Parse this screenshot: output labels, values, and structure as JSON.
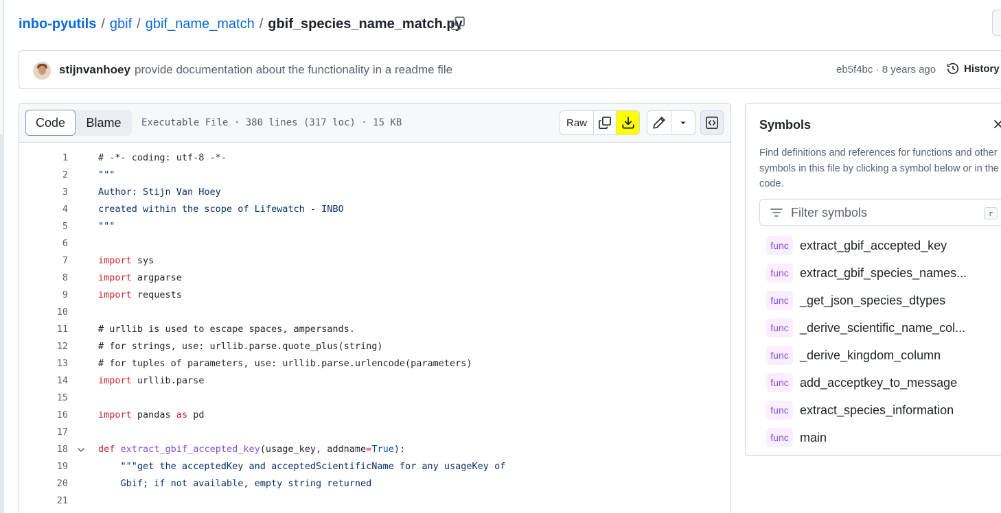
{
  "breadcrumb": {
    "repo": "inbo-pyutils",
    "dir1": "gbif",
    "dir2": "gbif_name_match",
    "file": "gbif_species_name_match.py",
    "separator": "/"
  },
  "commit": {
    "author": "stijnvanhoey",
    "message": "provide documentation about the functionality in a readme file",
    "meta": "eb5f4bc · 8 years ago",
    "history_label": "History"
  },
  "viewer": {
    "tabs": [
      "Code",
      "Blame"
    ],
    "active_tab": "Code",
    "file_info": "Executable File · 380 lines (317 loc) · 15 KB",
    "raw_label": "Raw",
    "download_highlight_color": "#ffff00"
  },
  "code_lines": [
    {
      "n": "1",
      "t": "# -*- coding: utf-8 -*-"
    },
    {
      "n": "2",
      "t": "\"\"\""
    },
    {
      "n": "3",
      "t": "Author: Stijn Van Hoey"
    },
    {
      "n": "4",
      "t": "created within the scope of Lifewatch - INBO"
    },
    {
      "n": "5",
      "t": "\"\"\""
    },
    {
      "n": "6",
      "t": ""
    },
    {
      "n": "7",
      "kw": "import",
      "t": " sys"
    },
    {
      "n": "8",
      "kw": "import",
      "t": " argparse"
    },
    {
      "n": "9",
      "kw": "import",
      "t": " requests"
    },
    {
      "n": "10",
      "t": ""
    },
    {
      "n": "11",
      "t": "# urllib is used to escape spaces, ampersands."
    },
    {
      "n": "12",
      "t": "# for strings, use: urllib.parse.quote_plus(string)"
    },
    {
      "n": "13",
      "t": "# for tuples of parameters, use: urllib.parse.urlencode(parameters)"
    },
    {
      "n": "14",
      "kw": "import",
      "t": " urllib.parse"
    },
    {
      "n": "15",
      "t": ""
    },
    {
      "n": "16",
      "kw": "import",
      "t": " pandas ",
      "kw2": "as",
      "t2": " pd"
    },
    {
      "n": "17",
      "t": ""
    },
    {
      "n": "18",
      "def": true,
      "kw": "def",
      "fn": "extract_gbif_accepted_key",
      "t": "(usage_key, addname",
      "op": "=",
      "bl": "True",
      "t2": "):"
    },
    {
      "n": "19",
      "t": "    \"\"\"get the acceptedKey and acceptedScientificName for any usageKey of"
    },
    {
      "n": "20",
      "t": "    Gbif; if not available, empty string returned"
    },
    {
      "n": "21",
      "t": ""
    }
  ],
  "symbols": {
    "title": "Symbols",
    "description": "Find definitions and references for functions and other symbols in this file by clicking a symbol below or in the code.",
    "filter_placeholder": "Filter symbols",
    "shortcut": "r",
    "badge": "func",
    "items": [
      "extract_gbif_accepted_key",
      "extract_gbif_species_names...",
      "_get_json_species_dtypes",
      "_derive_scientific_name_col...",
      "_derive_kingdom_column",
      "add_acceptkey_to_message",
      "extract_species_information",
      "main"
    ]
  },
  "colors": {
    "link": "#0969da",
    "keyword": "#cf222e",
    "function": "#8250df",
    "badge_bg": "#fbefff"
  }
}
